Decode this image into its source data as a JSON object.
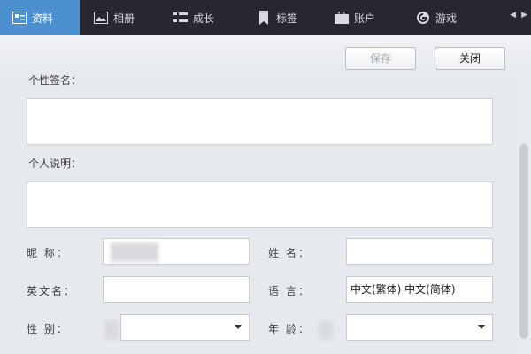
{
  "tabs": [
    {
      "label": "资料",
      "icon": "profile-card-icon",
      "active": true
    },
    {
      "label": "相册",
      "icon": "photo-album-icon",
      "active": false
    },
    {
      "label": "成长",
      "icon": "growth-list-icon",
      "active": false
    },
    {
      "label": "标签",
      "icon": "bookmark-icon",
      "active": false
    },
    {
      "label": "账户",
      "icon": "briefcase-icon",
      "active": false
    },
    {
      "label": "游戏",
      "icon": "game-icon",
      "active": false
    }
  ],
  "toolbar": {
    "save_label": "保存",
    "close_label": "关闭"
  },
  "form": {
    "signature_label": "个性签名：",
    "description_label": "个人说明：",
    "nickname_label": "昵  称：",
    "name_label": "姓  名：",
    "english_name_label": "英文名：",
    "language_label": "语  言：",
    "language_value": "中文(繁体)  中文(简体)",
    "gender_label": "性  别：",
    "age_label": "年  龄："
  },
  "colors": {
    "tabbar_bg": "#26272f",
    "active_tab": "#4c90cf"
  }
}
